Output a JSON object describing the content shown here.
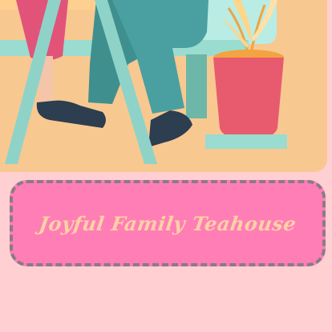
{
  "title": {
    "text": "Joyful Family Teahouse"
  },
  "illustration": {
    "icon": "family-at-table-illustration"
  },
  "colors": {
    "background": "#ffcfd2",
    "illustration_bg": "#f8c891",
    "title_box": "#ff7eb6",
    "title_border": "#8a7b86",
    "title_text": "#ffd2a5",
    "pot": "#e85b6f",
    "chair": "#8fd3c8"
  }
}
